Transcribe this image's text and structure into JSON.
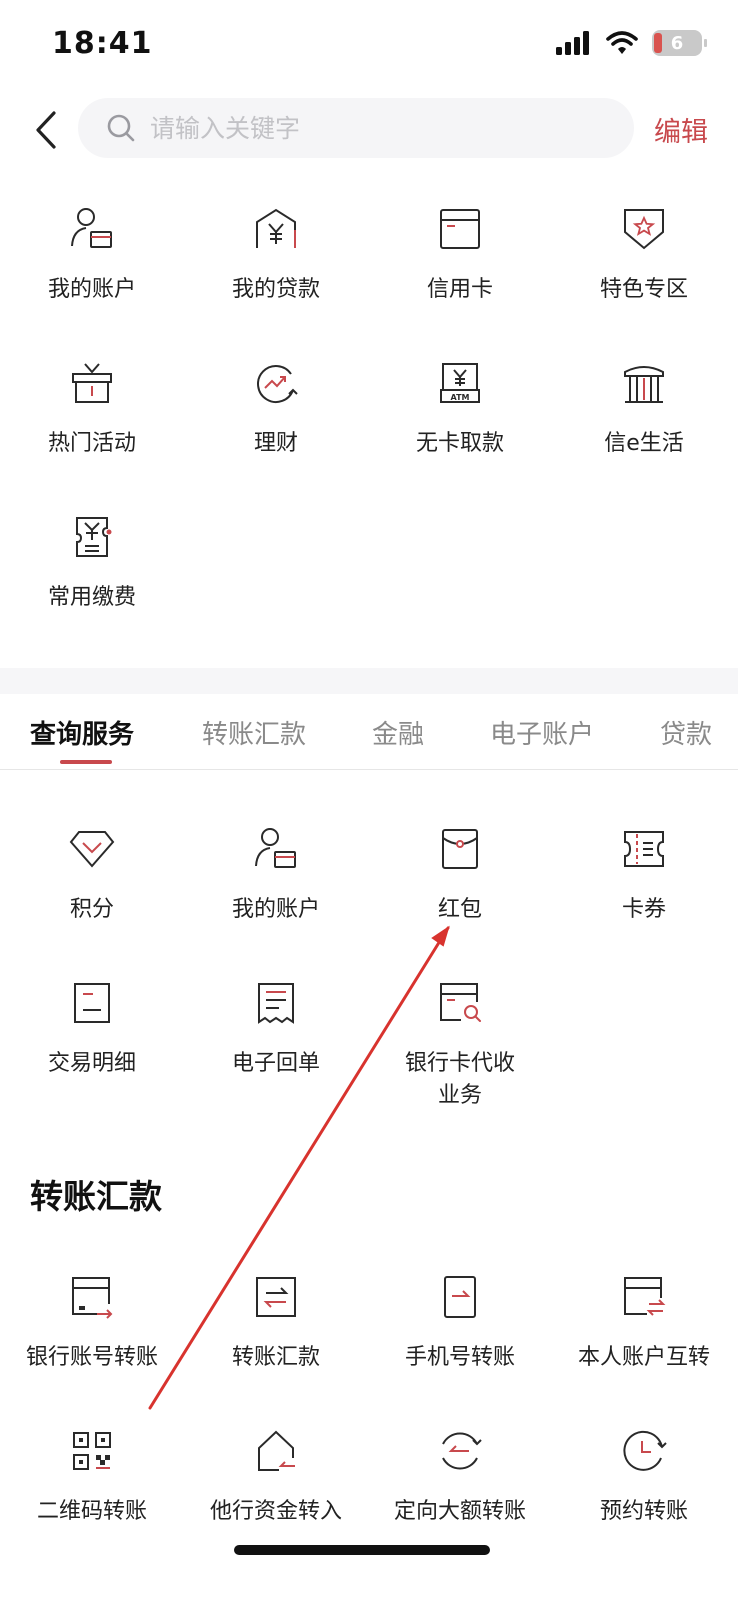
{
  "status_bar": {
    "time": "18:41",
    "battery": "6"
  },
  "header": {
    "search_placeholder": "请输入关键字",
    "edit_label": "编辑"
  },
  "favorites": [
    {
      "label": "我的账户",
      "icon": "account-card-icon"
    },
    {
      "label": "我的贷款",
      "icon": "loan-house-icon"
    },
    {
      "label": "信用卡",
      "icon": "credit-card-icon"
    },
    {
      "label": "特色专区",
      "icon": "star-badge-icon"
    },
    {
      "label": "热门活动",
      "icon": "gift-icon"
    },
    {
      "label": "理财",
      "icon": "growth-chart-icon"
    },
    {
      "label": "无卡取款",
      "icon": "atm-icon"
    },
    {
      "label": "信e生活",
      "icon": "bank-building-icon"
    },
    {
      "label": "常用缴费",
      "icon": "bill-icon"
    }
  ],
  "tabs": [
    "查询服务",
    "转账汇款",
    "金融",
    "电子账户",
    "贷款"
  ],
  "active_tab": 0,
  "query_services": [
    {
      "label": "积分",
      "icon": "diamond-icon"
    },
    {
      "label": "我的账户",
      "icon": "account-card-icon"
    },
    {
      "label": "红包",
      "icon": "red-envelope-icon"
    },
    {
      "label": "卡券",
      "icon": "ticket-icon"
    },
    {
      "label": "交易明细",
      "icon": "transaction-detail-icon"
    },
    {
      "label": "电子回单",
      "icon": "receipt-icon"
    },
    {
      "label": "银行卡代收\n业务",
      "icon": "card-search-icon"
    }
  ],
  "transfer_section": {
    "title": "转账汇款"
  },
  "transfer_services": [
    {
      "label": "银行账号转账",
      "icon": "bank-account-transfer-icon"
    },
    {
      "label": "转账汇款",
      "icon": "transfer-exchange-icon"
    },
    {
      "label": "手机号转账",
      "icon": "phone-transfer-icon"
    },
    {
      "label": "本人账户互转",
      "icon": "self-transfer-icon"
    },
    {
      "label": "二维码转账",
      "icon": "qr-code-icon"
    },
    {
      "label": "他行资金转入",
      "icon": "house-transfer-icon"
    },
    {
      "label": "定向大额转账",
      "icon": "directed-transfer-icon"
    },
    {
      "label": "预约转账",
      "icon": "clock-transfer-icon"
    }
  ],
  "colors": {
    "accent": "#c8494d",
    "icon_stroke": "#2a2a2a",
    "annotation_arrow": "#d8332e"
  }
}
